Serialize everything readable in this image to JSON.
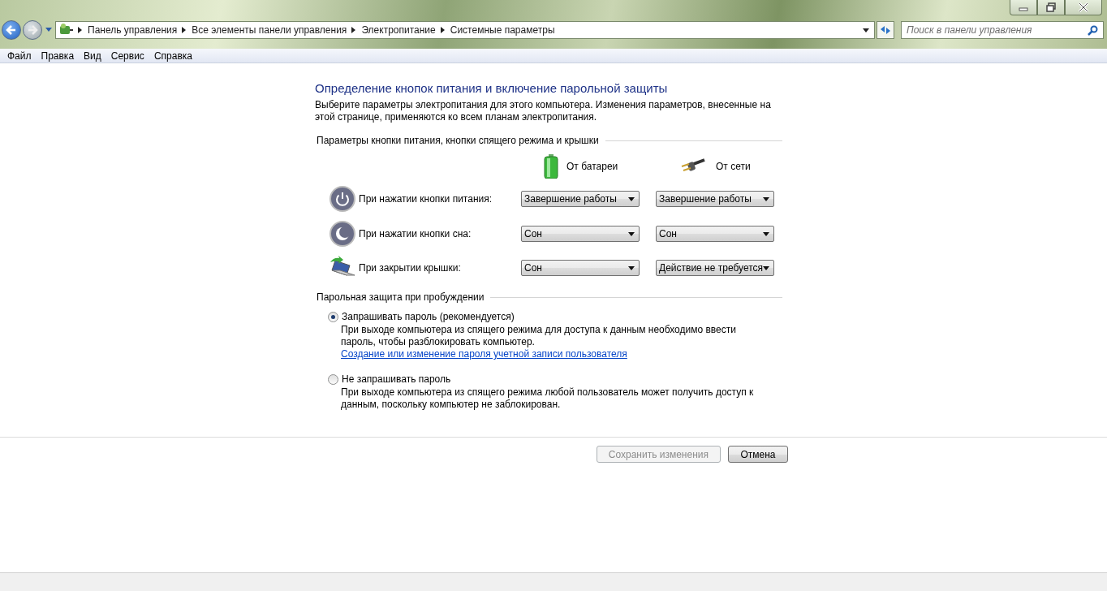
{
  "address_bar": {
    "breadcrumbs": [
      "Панель управления",
      "Все элементы панели управления",
      "Электропитание",
      "Системные параметры"
    ],
    "search": {
      "placeholder": "Поиск в панели управления"
    }
  },
  "menu": [
    "Файл",
    "Правка",
    "Вид",
    "Сервис",
    "Справка"
  ],
  "page": {
    "title": "Определение кнопок питания и включение парольной защиты",
    "description": "Выберите параметры электропитания для этого компьютера. Изменения параметров, внесенные на этой странице, применяются ко всем планам электропитания."
  },
  "power_section": {
    "title": "Параметры кнопки питания, кнопки спящего режима и крышки",
    "columns": [
      {
        "kind": "battery",
        "label": "От батареи"
      },
      {
        "kind": "plug",
        "label": "От сети"
      }
    ],
    "rows": [
      {
        "kind": "power",
        "label": "При нажатии кнопки питания:",
        "values": [
          "Завершение работы",
          "Завершение работы"
        ]
      },
      {
        "kind": "sleep",
        "label": "При нажатии кнопки сна:",
        "values": [
          "Сон",
          "Сон"
        ]
      },
      {
        "kind": "lid",
        "label": "При закрытии крышки:",
        "values": [
          "Сон",
          "Действие не требуется"
        ]
      }
    ]
  },
  "password_section": {
    "title": "Парольная защита при пробуждении",
    "options": [
      {
        "label": "Запрашивать пароль (рекомендуется)",
        "selected": true,
        "description": "При выходе компьютера из спящего режима для доступа к данным необходимо ввести пароль, чтобы разблокировать компьютер.",
        "link": "Создание или изменение пароля учетной записи пользователя"
      },
      {
        "label": "Не запрашивать пароль",
        "selected": false,
        "description": "При выходе компьютера из спящего режима любой пользователь может получить доступ к данным, поскольку компьютер не заблокирован."
      }
    ]
  },
  "buttons": [
    {
      "label": "Сохранить изменения",
      "disabled": true
    },
    {
      "label": "Отмена",
      "disabled": false
    }
  ]
}
